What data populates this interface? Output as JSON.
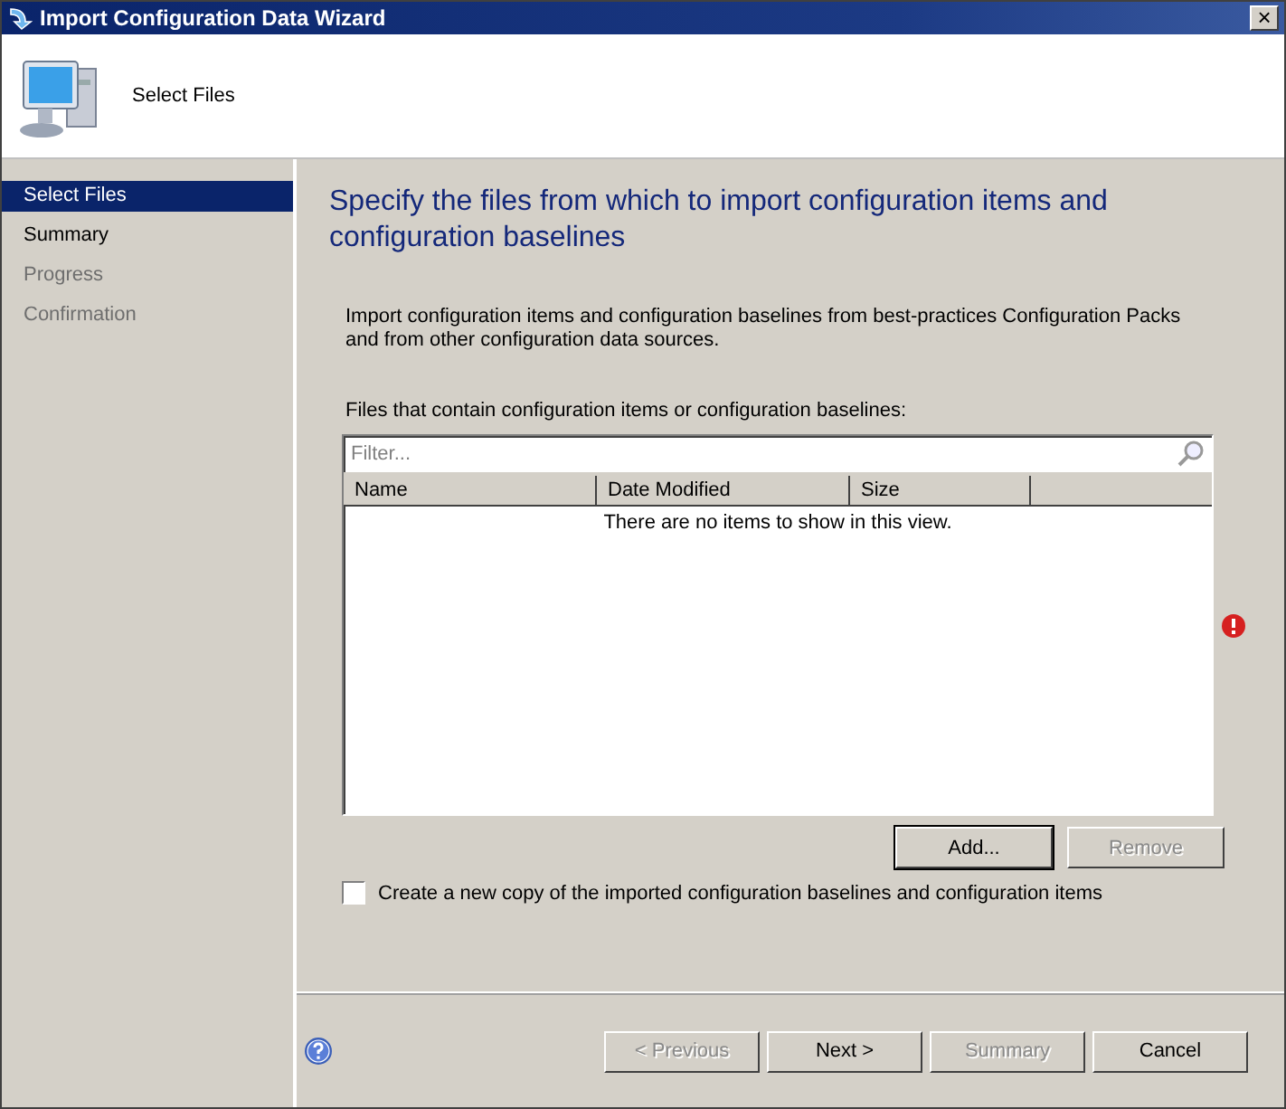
{
  "window": {
    "title": "Import Configuration Data Wizard",
    "close": "×"
  },
  "header": {
    "title": "Select Files"
  },
  "sidebar": {
    "items": [
      {
        "label": "Select Files",
        "selected": true,
        "disabled": false
      },
      {
        "label": "Summary",
        "selected": false,
        "disabled": false
      },
      {
        "label": "Progress",
        "selected": false,
        "disabled": true
      },
      {
        "label": "Confirmation",
        "selected": false,
        "disabled": true
      }
    ]
  },
  "main": {
    "heading": "Specify the files from which to import configuration items and configuration baselines",
    "description": "Import configuration items and configuration baselines from best-practices Configuration Packs and from other configuration data sources.",
    "list_label": "Files that contain configuration items or configuration baselines:",
    "filter": {
      "placeholder": "Filter..."
    },
    "table": {
      "columns": [
        "Name",
        "Date Modified",
        "Size"
      ],
      "empty_message": "There are no items to show in this view."
    },
    "error": {
      "shown": true
    },
    "buttons": [
      {
        "label": "Add...",
        "disabled": false,
        "default": true
      },
      {
        "label": "Remove",
        "disabled": true,
        "default": false
      }
    ],
    "checkbox": {
      "label": "Create a new copy of the imported configuration baselines and configuration items",
      "checked": false
    }
  },
  "footer": {
    "buttons": [
      {
        "label": "< Previous",
        "disabled": true
      },
      {
        "label": "Next >",
        "disabled": false
      },
      {
        "label": "Summary",
        "disabled": true
      },
      {
        "label": "Cancel",
        "disabled": false
      }
    ]
  }
}
